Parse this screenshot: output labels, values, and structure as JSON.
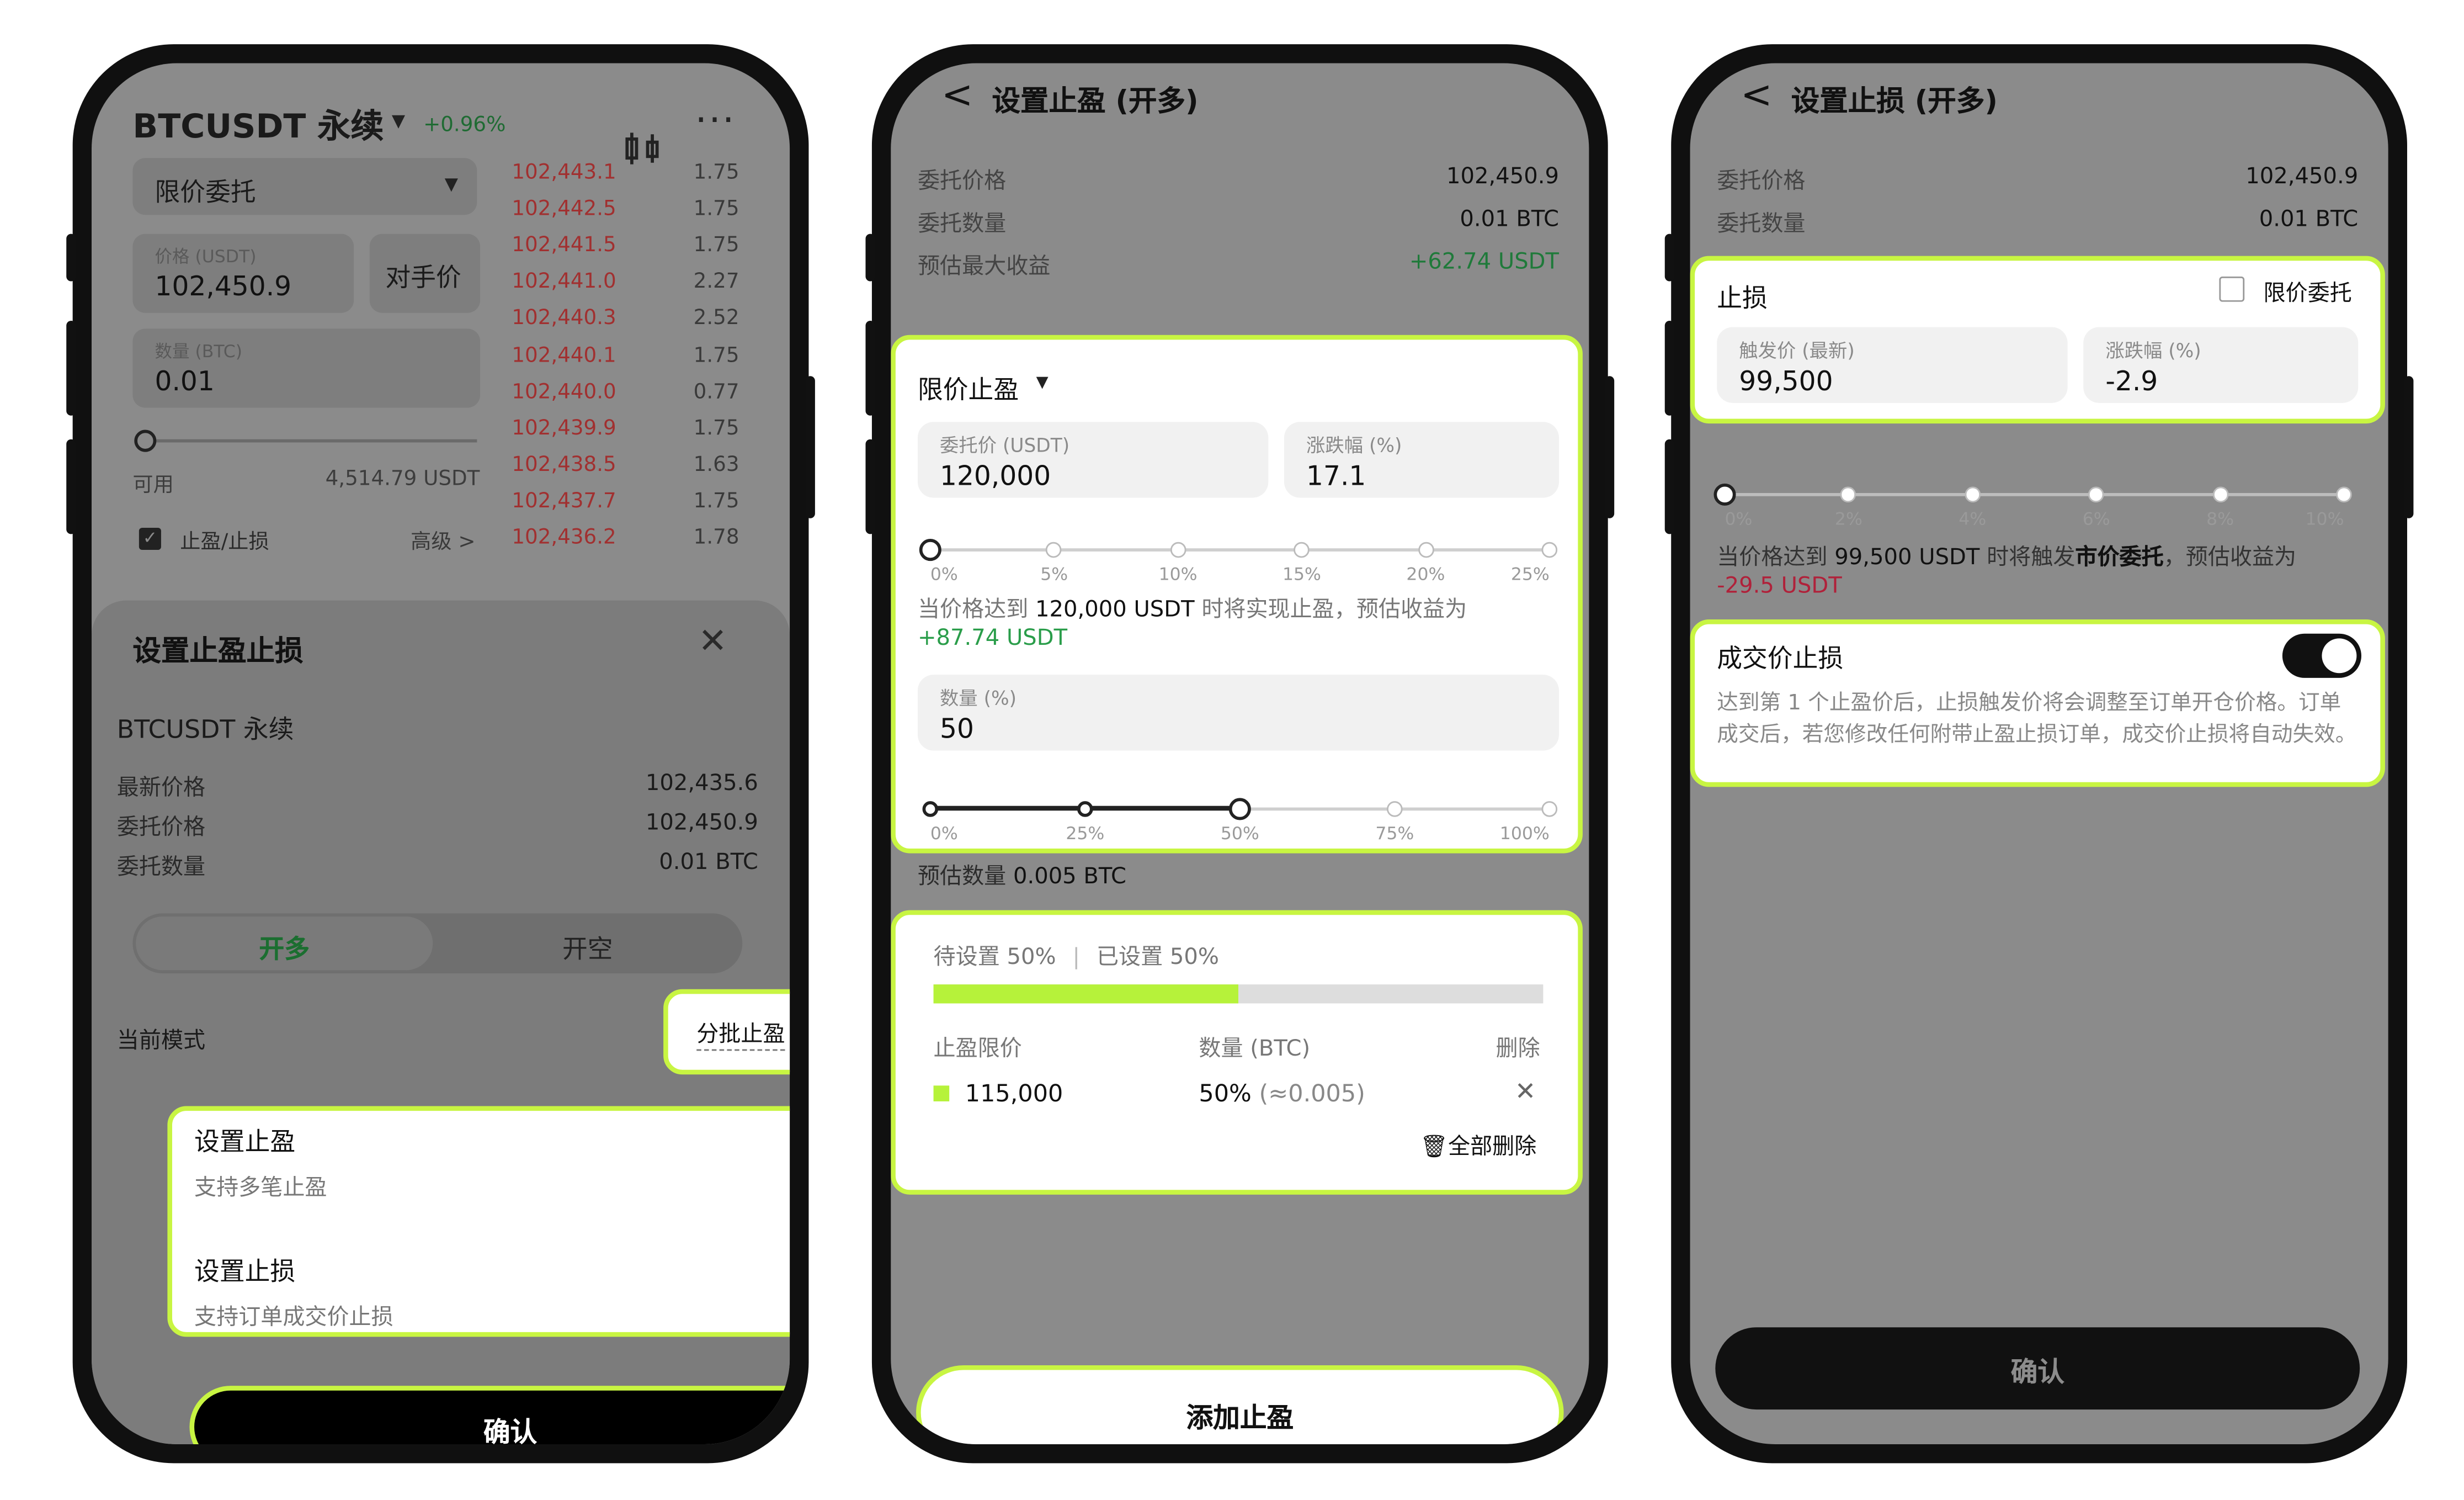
{
  "phone1": {
    "symbol": "BTCUSDT 永续",
    "change": "+0.96%",
    "order_type": "限价委托",
    "price_label": "价格 (USDT)",
    "price_value": "102,450.9",
    "counter_price": "对手价",
    "qty_label": "数量 (BTC)",
    "qty_value": "0.01",
    "available_label": "可用",
    "available_value": "4,514.79 USDT",
    "tp_sl_label": "止盈/止损",
    "advanced_label": "高级 >",
    "orderbook_prices": [
      "102,443.1",
      "102,442.5",
      "102,441.5",
      "102,441.0",
      "102,440.3",
      "102,440.1",
      "102,440.0",
      "102,439.9",
      "102,438.5",
      "102,437.7",
      "102,436.2"
    ],
    "orderbook_qty": [
      "1.75",
      "1.75",
      "1.75",
      "2.27",
      "2.52",
      "1.75",
      "0.77",
      "1.75",
      "1.63",
      "1.75",
      "1.78"
    ],
    "sheet": {
      "title": "设置止盈止损",
      "symbol": "BTCUSDT 永续",
      "rows": [
        {
          "label": "最新价格",
          "value": "102,435.6"
        },
        {
          "label": "委托价格",
          "value": "102,450.9"
        },
        {
          "label": "委托数量",
          "value": "0.01 BTC"
        }
      ],
      "tab_long": "开多",
      "tab_short": "开空",
      "mode_label": "当前模式",
      "mode_value": "分批止盈",
      "set_tp_title": "设置止盈",
      "set_tp_sub": "支持多笔止盈",
      "set_sl_title": "设置止损",
      "set_sl_sub": "支持订单成交价止损",
      "confirm": "确认"
    }
  },
  "phone2": {
    "back": "<",
    "title": "设置止盈 (开多)",
    "rows": [
      {
        "label": "委托价格",
        "value": "102,450.9"
      },
      {
        "label": "委托数量",
        "value": "0.01 BTC"
      },
      {
        "label": "预估最大收益",
        "value": "+62.74 USDT"
      }
    ],
    "tp_type": "限价止盈",
    "order_price_label": "委托价 (USDT)",
    "order_price_value": "120,000",
    "change_label": "涨跌幅 (%)",
    "change_value": "17.1",
    "slider1_ticks": [
      "0%",
      "5%",
      "10%",
      "15%",
      "20%",
      "25%"
    ],
    "slider1_level": 0,
    "info_prefix": "当价格达到",
    "info_price": "120,000 USDT",
    "info_mid": "时将实现止盈，预估收益为",
    "info_profit": "+87.74 USDT",
    "qty_label": "数量 (%)",
    "qty_value": "50",
    "slider2_ticks": [
      "0%",
      "25%",
      "50%",
      "75%",
      "100%"
    ],
    "slider2_level": 0.5,
    "est_qty_label": "预估数量",
    "est_qty_value": "0.005 BTC",
    "pending": "待设置 50%",
    "already": "已设置 50%",
    "progress": 0.5,
    "table_headers": [
      "止盈限价",
      "数量 (BTC)",
      "删除"
    ],
    "table_row": {
      "price": "115,000",
      "qty": "50%",
      "qty_approx": "(≈0.005)"
    },
    "delete_all": "全部删除",
    "add_button": "添加止盈"
  },
  "phone3": {
    "back": "<",
    "title": "设置止损 (开多)",
    "rows": [
      {
        "label": "委托价格",
        "value": "102,450.9"
      },
      {
        "label": "委托数量",
        "value": "0.01 BTC"
      }
    ],
    "sl_title": "止损",
    "limit_order_label": "限价委托",
    "trigger_label": "触发价 (最新)",
    "trigger_value": "99,500",
    "change_label": "涨跌幅 (%)",
    "change_value": "-2.9",
    "slider_ticks": [
      "0%",
      "2%",
      "4%",
      "6%",
      "8%",
      "10%"
    ],
    "slider_level": 0,
    "info_prefix": "当价格达到",
    "info_price": "99,500 USDT",
    "info_mid": "时将触发",
    "info_market": "市价委托",
    "info_suffix": "，预估收益为",
    "info_loss": "-29.5 USDT",
    "fill_sl_title": "成交价止损",
    "fill_sl_desc": "达到第 1 个止盈价后，止损触发价将会调整至订单开仓价格。订单成交后，若您修改任何附带止盈止损订单，成交价止损将自动失效。",
    "toggle_on": true,
    "confirm": "确认"
  },
  "colors": {
    "accent": "#c8f542",
    "profit": "#2a9d4a",
    "loss": "#b0213a",
    "progress": "#b6f23a"
  }
}
